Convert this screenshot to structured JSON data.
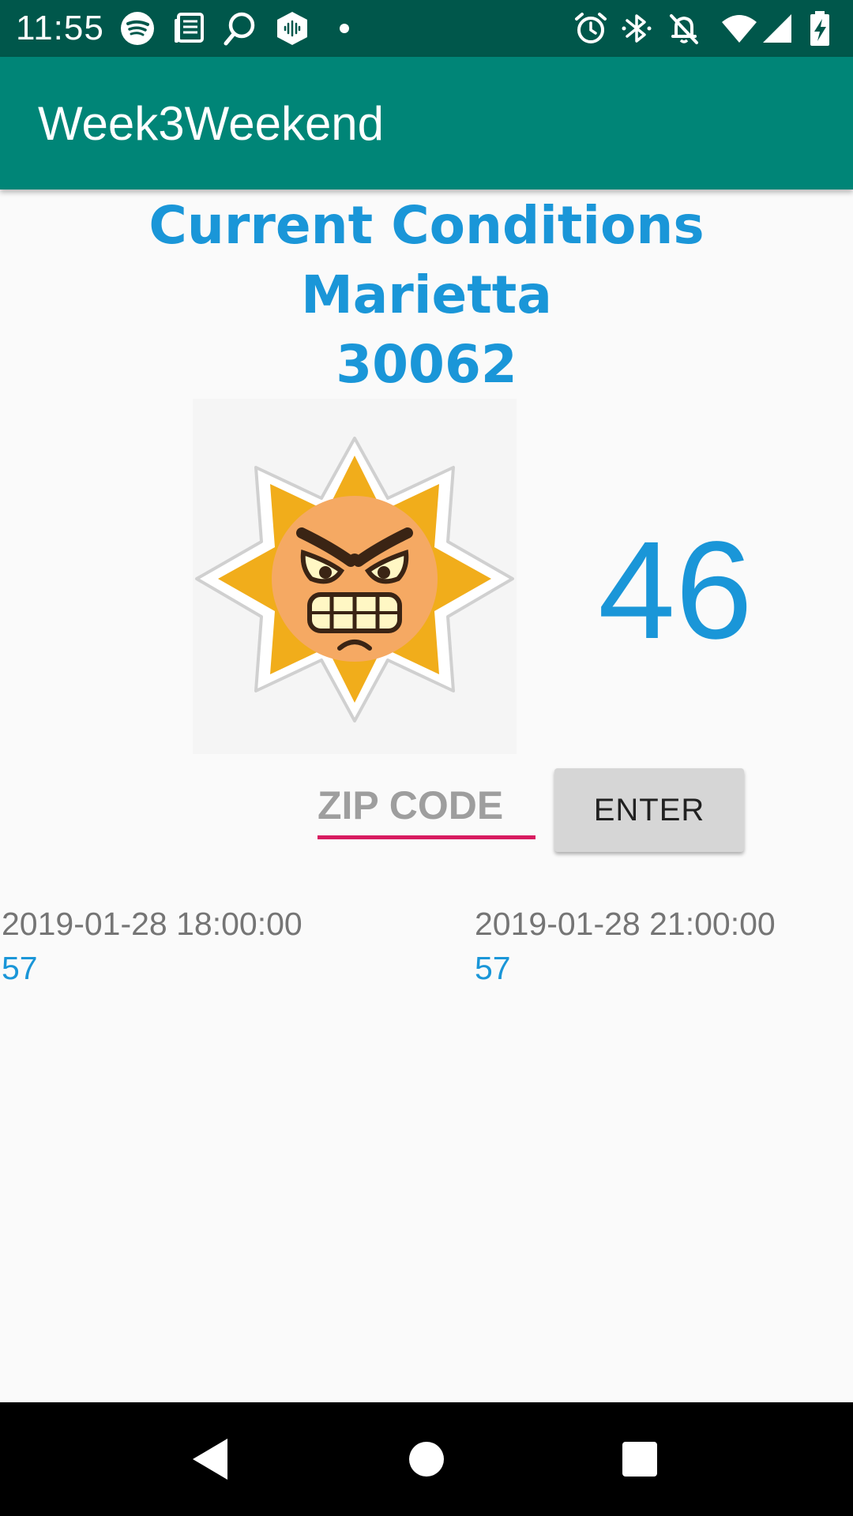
{
  "status_bar": {
    "time": "11:55",
    "left_icons": [
      "spotify-icon",
      "news-icon",
      "search-icon",
      "podcast-icon",
      "dot-icon"
    ],
    "right_icons": [
      "alarm-icon",
      "bluetooth-icon",
      "notifications-off-icon",
      "wifi-icon",
      "signal-icon",
      "battery-charging-icon"
    ]
  },
  "app_bar": {
    "title": "Week3Weekend"
  },
  "current": {
    "heading": "Current Conditions",
    "city": "Marietta",
    "zip": "30062",
    "temperature": "46",
    "image_icon": "angry-sun-icon"
  },
  "zip_input": {
    "placeholder": "ZIP CODE",
    "value": ""
  },
  "enter_button": {
    "label": "ENTER"
  },
  "forecast": [
    {
      "time": "2019-01-28 18:00:00",
      "temp": "57"
    },
    {
      "time": "2019-01-28 21:00:00",
      "temp": "57"
    }
  ],
  "nav_bar": {
    "buttons": [
      "back-icon",
      "home-icon",
      "recents-icon"
    ]
  },
  "colors": {
    "status_bar": "#00574b",
    "app_bar": "#008577",
    "accent_text": "#1a96d8",
    "input_underline": "#d81b60",
    "button_bg": "#d6d6d6",
    "background": "#fafafa"
  }
}
